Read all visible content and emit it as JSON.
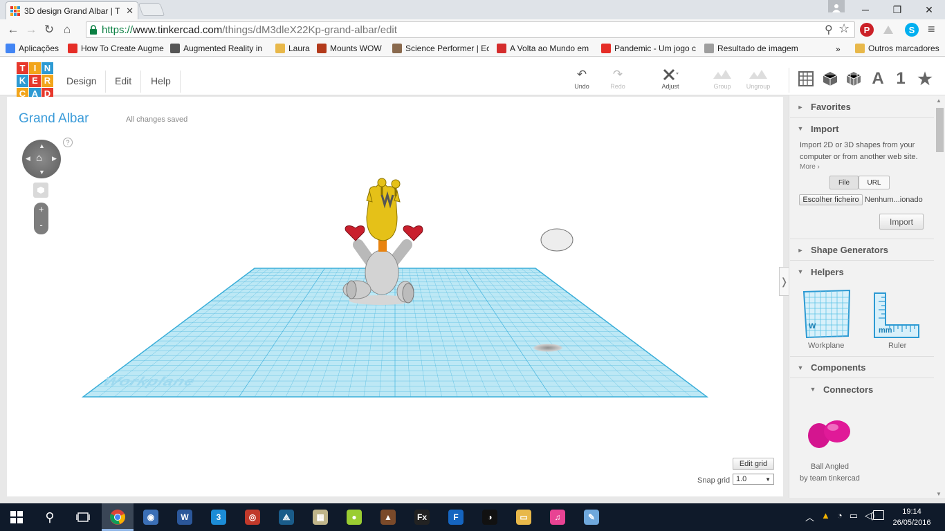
{
  "browser": {
    "tab_title": "3D design Grand Albar | T",
    "url_scheme": "https://",
    "url_host": "www.tinkercad.com",
    "url_path": "/things/dM3dleX22Kp-grand-albar/edit",
    "bookmarks": [
      {
        "label": "Aplicações",
        "color": "#4285f4"
      },
      {
        "label": "How To Create Augme",
        "color": "#e52d27"
      },
      {
        "label": "Augmented Reality in",
        "color": "#555555"
      },
      {
        "label": "Laura",
        "color": "#e8b84a"
      },
      {
        "label": "Mounts WOW",
        "color": "#b33a1b"
      },
      {
        "label": "Science Performer | Ec",
        "color": "#8a6a4e"
      },
      {
        "label": "A Volta ao Mundo em",
        "color": "#d42c2c"
      },
      {
        "label": "Pandemic - Um jogo c",
        "color": "#e52d27"
      },
      {
        "label": "Resultado de imagem",
        "color": "#9e9e9e"
      }
    ],
    "more_bookmarks": "»",
    "other_bookmarks": "Outros marcadores"
  },
  "app": {
    "logo_letters": [
      "T",
      "I",
      "N",
      "K",
      "E",
      "R",
      "C",
      "A",
      "D"
    ],
    "logo_colors": [
      "#e7382c",
      "#f2a51b",
      "#2d9ad3",
      "#2d9ad3",
      "#e7382c",
      "#f2a51b",
      "#f2a51b",
      "#2d9ad3",
      "#e7382c"
    ],
    "menu": [
      "Design",
      "Edit",
      "Help"
    ],
    "tools": {
      "undo": "Undo",
      "redo": "Redo",
      "adjust": "Adjust",
      "group": "Group",
      "ungroup": "Ungroup"
    },
    "view_text_a": "A",
    "view_text_1": "1",
    "design_title": "Grand Albar",
    "save_status": "All changes saved",
    "help_q": "?",
    "zoom_in": "+",
    "zoom_out": "-",
    "workplane_label": "Workplane",
    "edit_grid": "Edit grid",
    "snap_label": "Snap grid",
    "snap_value": "1.0"
  },
  "panel": {
    "favorites": "Favorites",
    "import": "Import",
    "import_desc": "Import 2D or 3D shapes from your computer or from another web site.",
    "more": "More ›",
    "file_tab": "File",
    "url_tab": "URL",
    "choose_file": "Escolher ficheiro",
    "no_file": "Nenhum...ionado",
    "import_button": "Import",
    "shape_generators": "Shape Generators",
    "helpers": "Helpers",
    "helper_items": [
      "Workplane",
      "Ruler"
    ],
    "ruler_unit": "mm",
    "workplane_mark": "W",
    "components": "Components",
    "connectors": "Connectors",
    "connector_name": "Ball Angled",
    "connector_author": "by team tinkercad"
  },
  "taskbar": {
    "time": "19:14",
    "date": "26/05/2016"
  },
  "colors": {
    "accent": "#3a9bd9",
    "grid": "#5ec3e6",
    "taskbar": "#0f1a2a"
  }
}
